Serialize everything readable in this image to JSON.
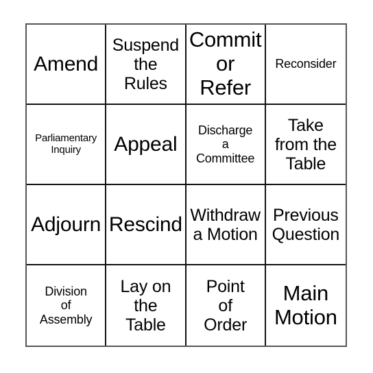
{
  "card": {
    "type": "bingo-card",
    "columns": 4,
    "rows": 4,
    "border_color": "#555555",
    "grid_line_color": "#111111",
    "background_color": "#ffffff",
    "text_color": "#000000",
    "cells": [
      {
        "text": "Amend",
        "size": "lg"
      },
      {
        "text": "Suspend\nthe\nRules",
        "size": "md"
      },
      {
        "text": "Commit\nor\nRefer",
        "size": "xl"
      },
      {
        "text": "Reconsider",
        "size": "sm"
      },
      {
        "text": "Parliamentary\nInquiry",
        "size": "xs"
      },
      {
        "text": "Appeal",
        "size": "lg"
      },
      {
        "text": "Discharge\na\nCommittee",
        "size": "sm"
      },
      {
        "text": "Take\nfrom the\nTable",
        "size": "md"
      },
      {
        "text": "Adjourn",
        "size": "lg"
      },
      {
        "text": "Rescind",
        "size": "lg"
      },
      {
        "text": "Withdraw\na Motion",
        "size": "md"
      },
      {
        "text": "Previous\nQuestion",
        "size": "md"
      },
      {
        "text": "Division\nof\nAssembly",
        "size": "sm"
      },
      {
        "text": "Lay on\nthe\nTable",
        "size": "md"
      },
      {
        "text": "Point\nof\nOrder",
        "size": "md"
      },
      {
        "text": "Main\nMotion",
        "size": "xl"
      }
    ]
  }
}
